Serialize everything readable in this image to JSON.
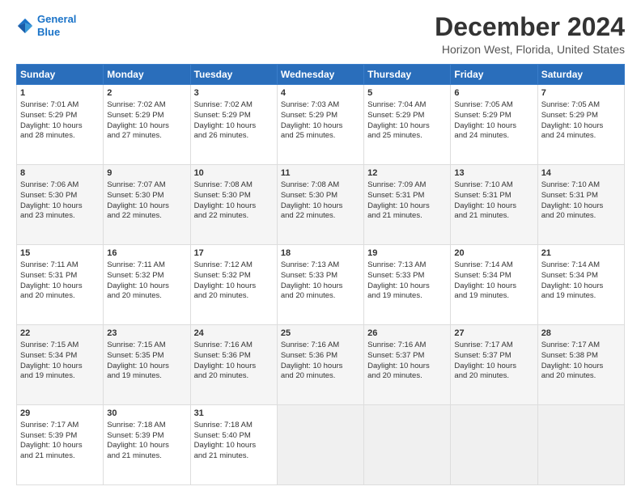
{
  "logo": {
    "line1": "General",
    "line2": "Blue"
  },
  "title": "December 2024",
  "subtitle": "Horizon West, Florida, United States",
  "weekdays": [
    "Sunday",
    "Monday",
    "Tuesday",
    "Wednesday",
    "Thursday",
    "Friday",
    "Saturday"
  ],
  "weeks": [
    [
      {
        "day": "1",
        "lines": [
          "Sunrise: 7:01 AM",
          "Sunset: 5:29 PM",
          "Daylight: 10 hours",
          "and 28 minutes."
        ]
      },
      {
        "day": "2",
        "lines": [
          "Sunrise: 7:02 AM",
          "Sunset: 5:29 PM",
          "Daylight: 10 hours",
          "and 27 minutes."
        ]
      },
      {
        "day": "3",
        "lines": [
          "Sunrise: 7:02 AM",
          "Sunset: 5:29 PM",
          "Daylight: 10 hours",
          "and 26 minutes."
        ]
      },
      {
        "day": "4",
        "lines": [
          "Sunrise: 7:03 AM",
          "Sunset: 5:29 PM",
          "Daylight: 10 hours",
          "and 25 minutes."
        ]
      },
      {
        "day": "5",
        "lines": [
          "Sunrise: 7:04 AM",
          "Sunset: 5:29 PM",
          "Daylight: 10 hours",
          "and 25 minutes."
        ]
      },
      {
        "day": "6",
        "lines": [
          "Sunrise: 7:05 AM",
          "Sunset: 5:29 PM",
          "Daylight: 10 hours",
          "and 24 minutes."
        ]
      },
      {
        "day": "7",
        "lines": [
          "Sunrise: 7:05 AM",
          "Sunset: 5:29 PM",
          "Daylight: 10 hours",
          "and 24 minutes."
        ]
      }
    ],
    [
      {
        "day": "8",
        "lines": [
          "Sunrise: 7:06 AM",
          "Sunset: 5:30 PM",
          "Daylight: 10 hours",
          "and 23 minutes."
        ]
      },
      {
        "day": "9",
        "lines": [
          "Sunrise: 7:07 AM",
          "Sunset: 5:30 PM",
          "Daylight: 10 hours",
          "and 22 minutes."
        ]
      },
      {
        "day": "10",
        "lines": [
          "Sunrise: 7:08 AM",
          "Sunset: 5:30 PM",
          "Daylight: 10 hours",
          "and 22 minutes."
        ]
      },
      {
        "day": "11",
        "lines": [
          "Sunrise: 7:08 AM",
          "Sunset: 5:30 PM",
          "Daylight: 10 hours",
          "and 22 minutes."
        ]
      },
      {
        "day": "12",
        "lines": [
          "Sunrise: 7:09 AM",
          "Sunset: 5:31 PM",
          "Daylight: 10 hours",
          "and 21 minutes."
        ]
      },
      {
        "day": "13",
        "lines": [
          "Sunrise: 7:10 AM",
          "Sunset: 5:31 PM",
          "Daylight: 10 hours",
          "and 21 minutes."
        ]
      },
      {
        "day": "14",
        "lines": [
          "Sunrise: 7:10 AM",
          "Sunset: 5:31 PM",
          "Daylight: 10 hours",
          "and 20 minutes."
        ]
      }
    ],
    [
      {
        "day": "15",
        "lines": [
          "Sunrise: 7:11 AM",
          "Sunset: 5:31 PM",
          "Daylight: 10 hours",
          "and 20 minutes."
        ]
      },
      {
        "day": "16",
        "lines": [
          "Sunrise: 7:11 AM",
          "Sunset: 5:32 PM",
          "Daylight: 10 hours",
          "and 20 minutes."
        ]
      },
      {
        "day": "17",
        "lines": [
          "Sunrise: 7:12 AM",
          "Sunset: 5:32 PM",
          "Daylight: 10 hours",
          "and 20 minutes."
        ]
      },
      {
        "day": "18",
        "lines": [
          "Sunrise: 7:13 AM",
          "Sunset: 5:33 PM",
          "Daylight: 10 hours",
          "and 20 minutes."
        ]
      },
      {
        "day": "19",
        "lines": [
          "Sunrise: 7:13 AM",
          "Sunset: 5:33 PM",
          "Daylight: 10 hours",
          "and 19 minutes."
        ]
      },
      {
        "day": "20",
        "lines": [
          "Sunrise: 7:14 AM",
          "Sunset: 5:34 PM",
          "Daylight: 10 hours",
          "and 19 minutes."
        ]
      },
      {
        "day": "21",
        "lines": [
          "Sunrise: 7:14 AM",
          "Sunset: 5:34 PM",
          "Daylight: 10 hours",
          "and 19 minutes."
        ]
      }
    ],
    [
      {
        "day": "22",
        "lines": [
          "Sunrise: 7:15 AM",
          "Sunset: 5:34 PM",
          "Daylight: 10 hours",
          "and 19 minutes."
        ]
      },
      {
        "day": "23",
        "lines": [
          "Sunrise: 7:15 AM",
          "Sunset: 5:35 PM",
          "Daylight: 10 hours",
          "and 19 minutes."
        ]
      },
      {
        "day": "24",
        "lines": [
          "Sunrise: 7:16 AM",
          "Sunset: 5:36 PM",
          "Daylight: 10 hours",
          "and 20 minutes."
        ]
      },
      {
        "day": "25",
        "lines": [
          "Sunrise: 7:16 AM",
          "Sunset: 5:36 PM",
          "Daylight: 10 hours",
          "and 20 minutes."
        ]
      },
      {
        "day": "26",
        "lines": [
          "Sunrise: 7:16 AM",
          "Sunset: 5:37 PM",
          "Daylight: 10 hours",
          "and 20 minutes."
        ]
      },
      {
        "day": "27",
        "lines": [
          "Sunrise: 7:17 AM",
          "Sunset: 5:37 PM",
          "Daylight: 10 hours",
          "and 20 minutes."
        ]
      },
      {
        "day": "28",
        "lines": [
          "Sunrise: 7:17 AM",
          "Sunset: 5:38 PM",
          "Daylight: 10 hours",
          "and 20 minutes."
        ]
      }
    ],
    [
      {
        "day": "29",
        "lines": [
          "Sunrise: 7:17 AM",
          "Sunset: 5:39 PM",
          "Daylight: 10 hours",
          "and 21 minutes."
        ]
      },
      {
        "day": "30",
        "lines": [
          "Sunrise: 7:18 AM",
          "Sunset: 5:39 PM",
          "Daylight: 10 hours",
          "and 21 minutes."
        ]
      },
      {
        "day": "31",
        "lines": [
          "Sunrise: 7:18 AM",
          "Sunset: 5:40 PM",
          "Daylight: 10 hours",
          "and 21 minutes."
        ]
      },
      null,
      null,
      null,
      null
    ]
  ]
}
